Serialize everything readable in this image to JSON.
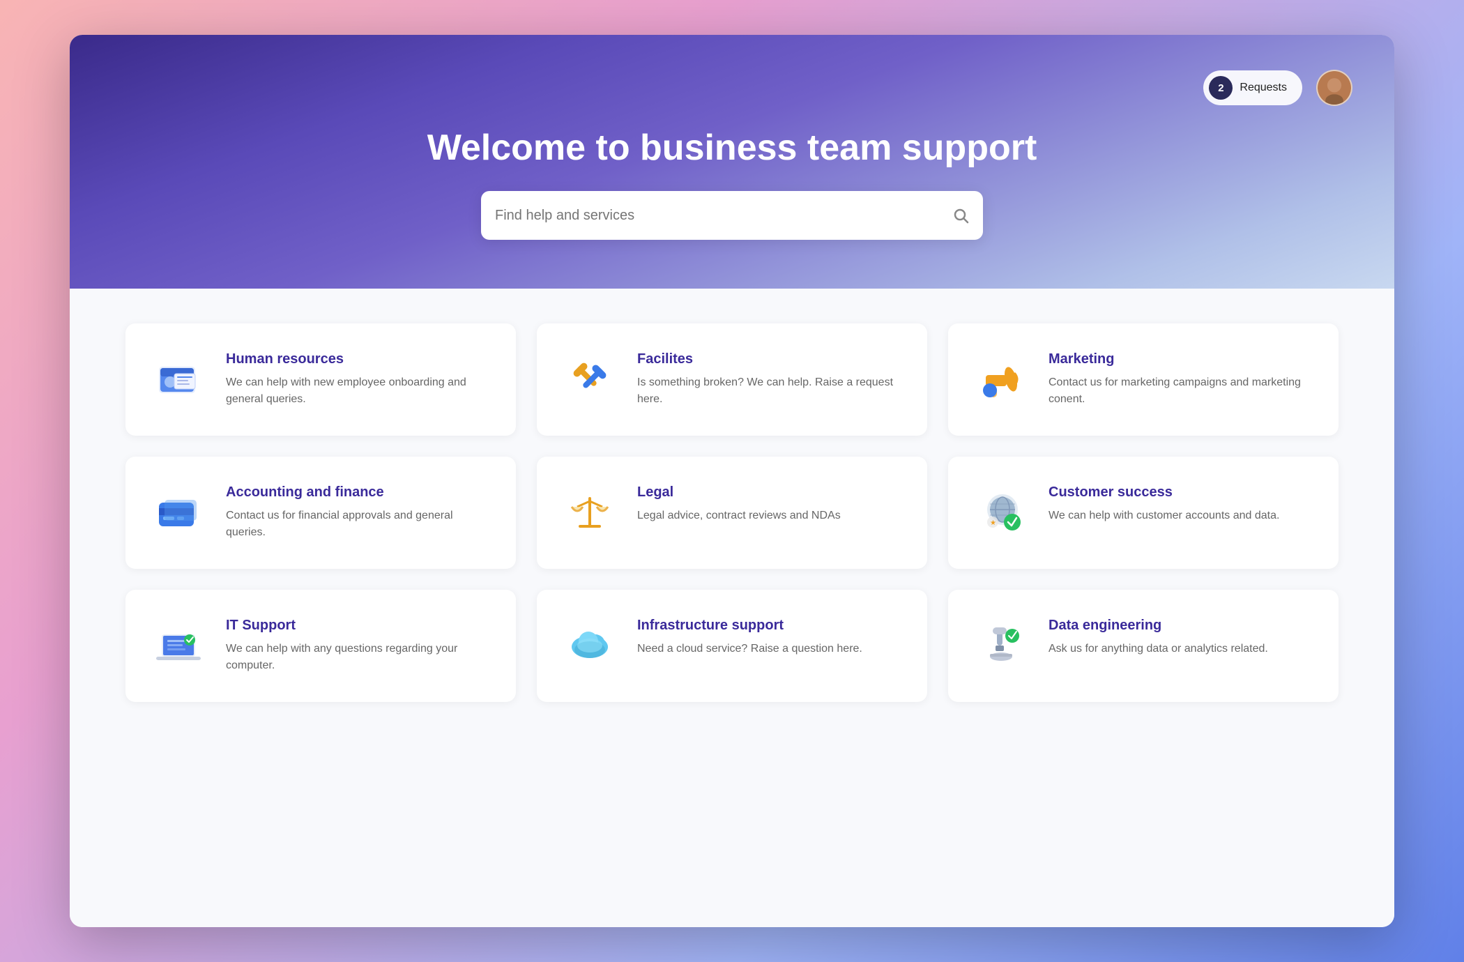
{
  "hero": {
    "title": "Welcome to business team support",
    "search_placeholder": "Find help and services",
    "requests_count": "2",
    "requests_label": "Requests"
  },
  "cards": [
    {
      "id": "human-resources",
      "title": "Human resources",
      "description": "We can help with new employee onboarding and general queries.",
      "icon": "hr"
    },
    {
      "id": "facilities",
      "title": "Facilites",
      "description": "Is something broken? We can help. Raise a request here.",
      "icon": "facilities"
    },
    {
      "id": "marketing",
      "title": "Marketing",
      "description": "Contact us for marketing campaigns and marketing conent.",
      "icon": "marketing"
    },
    {
      "id": "accounting-finance",
      "title": "Accounting and finance",
      "description": "Contact us for financial approvals and general queries.",
      "icon": "accounting"
    },
    {
      "id": "legal",
      "title": "Legal",
      "description": "Legal advice, contract reviews and NDAs",
      "icon": "legal"
    },
    {
      "id": "customer-success",
      "title": "Customer success",
      "description": "We can help with customer accounts and data.",
      "icon": "customer-success"
    },
    {
      "id": "it-support",
      "title": "IT Support",
      "description": "We can help with any questions regarding your computer.",
      "icon": "it"
    },
    {
      "id": "infrastructure-support",
      "title": "Infrastructure support",
      "description": "Need a cloud service? Raise a question here.",
      "icon": "infrastructure"
    },
    {
      "id": "data-engineering",
      "title": "Data engineering",
      "description": "Ask us for anything data or analytics related.",
      "icon": "data"
    }
  ]
}
